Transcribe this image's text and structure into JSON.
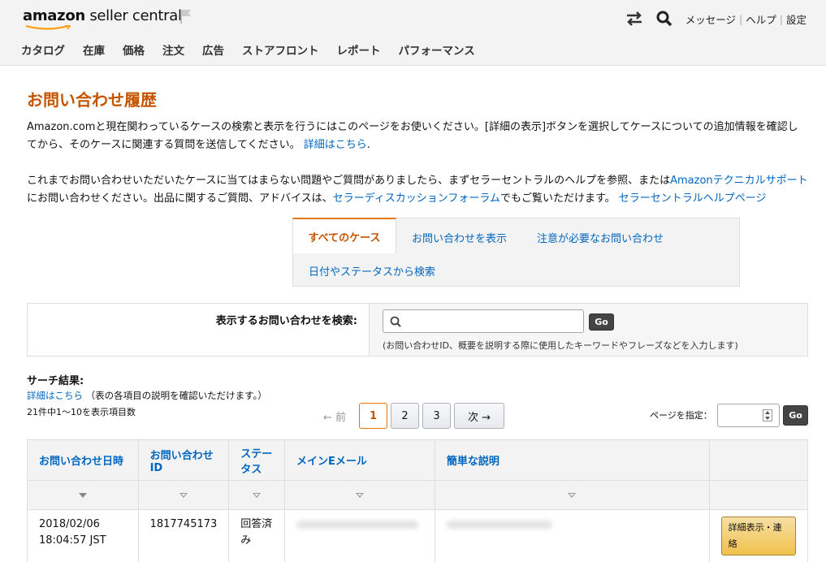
{
  "header": {
    "logo_brand": "amazon",
    "logo_text": " seller central",
    "links": [
      "メッセージ",
      "ヘルプ",
      "設定"
    ],
    "nav": [
      "カタログ",
      "在庫",
      "価格",
      "注文",
      "広告",
      "ストアフロント",
      "レポート",
      "パフォーマンス"
    ]
  },
  "page": {
    "title": "お問い合わせ履歴",
    "para1_text": "Amazon.comと現在関わっているケースの検索と表示を行うにはこのページをお使いください。[詳細の表示]ボタンを選択してケースについての追加情報を確認してから、そのケースに関連する質問を送信してください。",
    "para1_link": "詳細はこちら",
    "para1_end": ".",
    "para2_a": "これまでお問い合わせいただいたケースに当てはまらない問題やご質問がありましたら、まずセラーセントラルのヘルプを参照、または",
    "para2_link1": "Amazonテクニカルサポート",
    "para2_b": "にお問い合わせください。出品に関するご質問、アドバイスは、",
    "para2_link2": "セラーディスカッションフォーラム",
    "para2_c": "でもご覧いただけます。",
    "para2_link3": "セラーセントラルヘルプページ"
  },
  "tabs": {
    "all": "すべてのケース",
    "show": "お問い合わせを表示",
    "attention": "注意が必要なお問い合わせ",
    "search_by": "日付やステータスから検索"
  },
  "search": {
    "label": "表示するお問い合わせを検索:",
    "value": "",
    "go": "Go",
    "hint": "(お問い合わせID、概要を説明する際に使用したキーワードやフレーズなどを入力します)"
  },
  "results": {
    "title": "サーチ結果:",
    "help_link": "詳細はこちら",
    "help_text": "（表の各項目の説明を確認いただけます。）",
    "count": "21件中1〜10を表示項目数",
    "prev": "← 前",
    "pages": [
      "1",
      "2",
      "3"
    ],
    "next": "次 →",
    "page_spec": "ページを指定：",
    "go": "Go"
  },
  "table": {
    "headers": [
      "お問い合わせ日時",
      "お問い合わせID",
      "ステータス",
      "メインEメール",
      "簡単な説明"
    ],
    "rows": [
      {
        "date": "2018/02/06",
        "time": "18:04:57 JST",
        "id": "1817745173",
        "status": "回答済み",
        "action": "詳細表示・連絡"
      }
    ]
  }
}
